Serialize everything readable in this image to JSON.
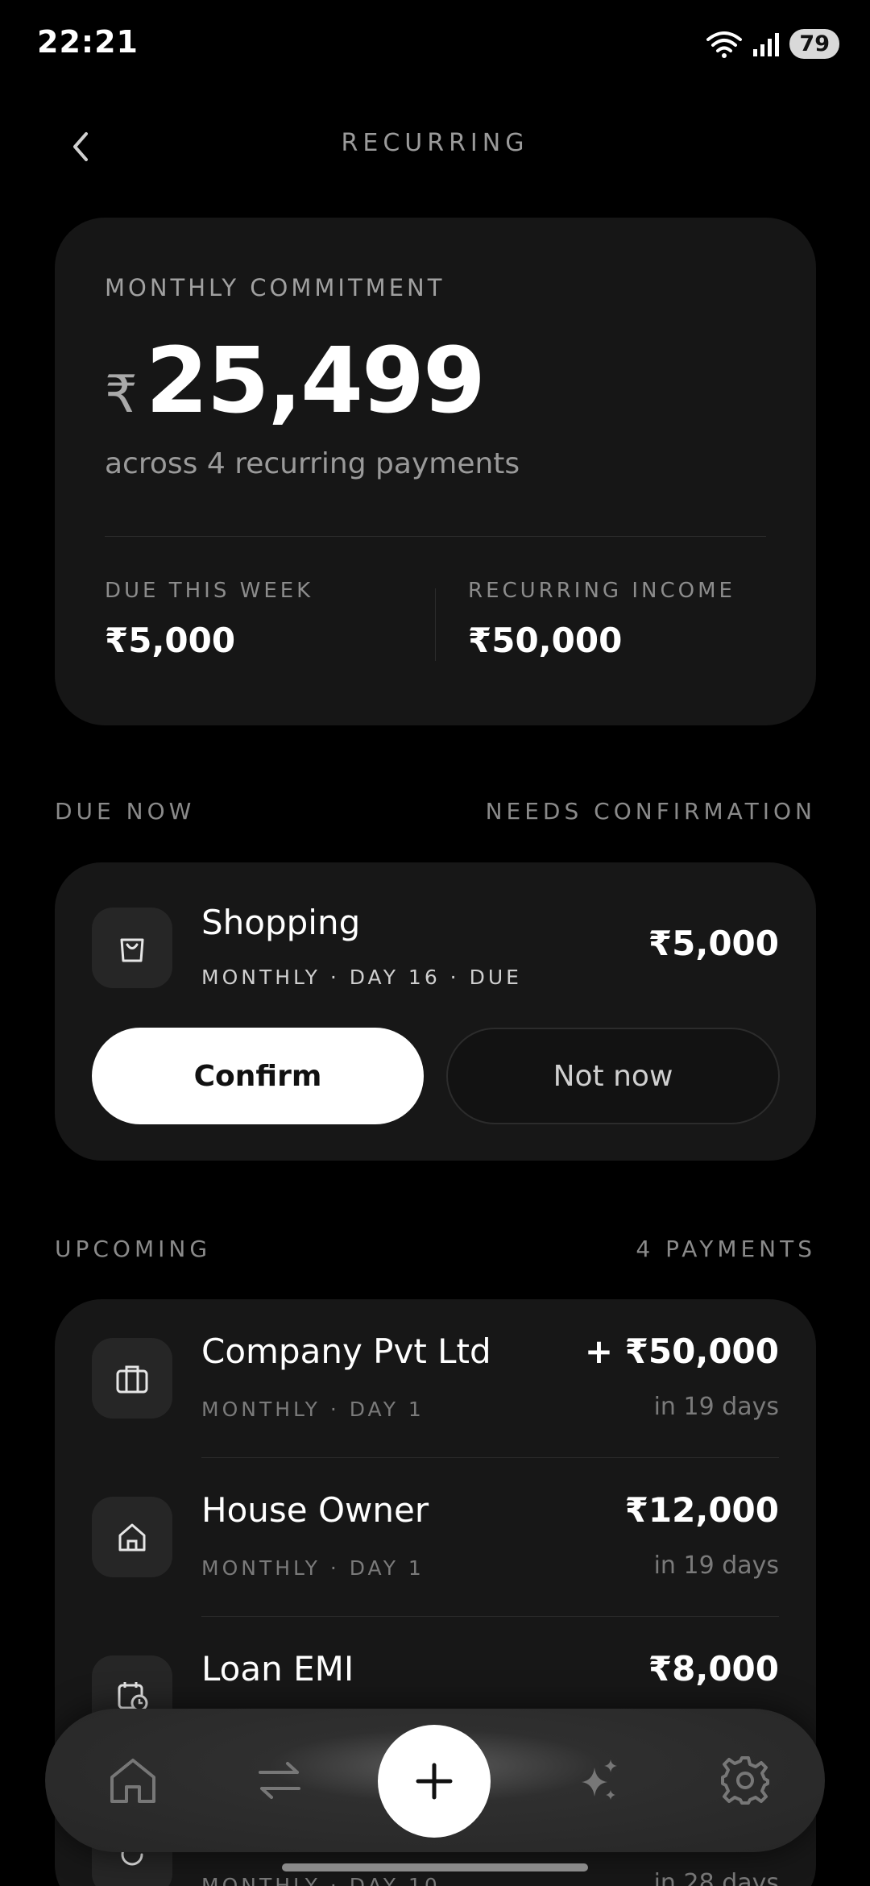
{
  "status": {
    "time": "22:21",
    "battery": "79"
  },
  "header": {
    "title": "RECURRING"
  },
  "summary": {
    "label": "MONTHLY COMMITMENT",
    "currency": "₹",
    "value": "25,499",
    "subtitle": "across 4 recurring payments",
    "due_label": "DUE THIS WEEK",
    "due_value": "₹5,000",
    "income_label": "RECURRING INCOME",
    "income_value": "₹50,000"
  },
  "due_now": {
    "title": "DUE NOW",
    "status": "NEEDS CONFIRMATION",
    "item": {
      "icon": "shopping-bag-icon",
      "name": "Shopping",
      "meta": "MONTHLY · DAY 16 · DUE",
      "amount": "₹5,000"
    },
    "confirm_label": "Confirm",
    "not_now_label": "Not now"
  },
  "upcoming": {
    "title": "UPCOMING",
    "count": "4 PAYMENTS",
    "items": [
      {
        "icon": "briefcase-icon",
        "name": "Company Pvt Ltd",
        "meta": "MONTHLY · DAY 1",
        "amount": "+ ₹50,000",
        "when": "in 19 days"
      },
      {
        "icon": "house-icon",
        "name": "House Owner",
        "meta": "MONTHLY · DAY 1",
        "amount": "₹12,000",
        "when": "in 19 days"
      },
      {
        "icon": "calendar-clock-icon",
        "name": "Loan EMI",
        "meta": "",
        "amount": "₹8,000",
        "when": ""
      },
      {
        "icon": "refresh-icon",
        "name": "",
        "meta": "MONTHLY · DAY 10",
        "amount": "",
        "when": "in 28 days"
      }
    ]
  },
  "nav": {
    "items": [
      "home-icon",
      "transfer-arrows-icon",
      "plus-icon",
      "sparkles-icon",
      "settings-gear-icon"
    ]
  }
}
